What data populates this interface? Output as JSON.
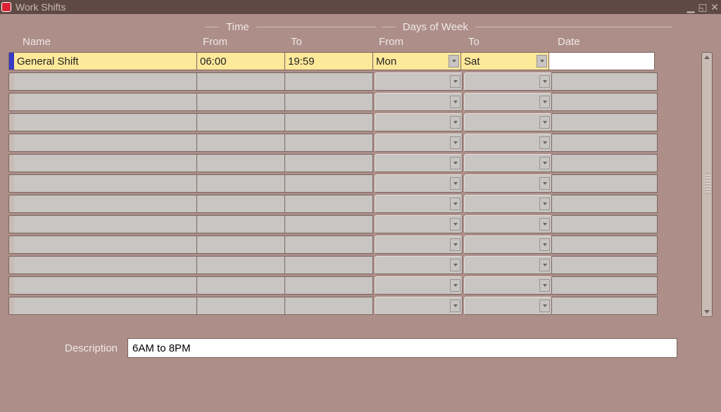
{
  "window": {
    "title": "Work Shifts"
  },
  "groups": {
    "time": "Time",
    "dow": "Days of Week"
  },
  "columns": {
    "name": "Name",
    "from": "From",
    "to": "To",
    "dfrom": "From",
    "dto": "To",
    "date": "Date"
  },
  "rows": [
    {
      "selected": true,
      "name": "General Shift",
      "from": "06:00",
      "to": "19:59",
      "dfrom": "Mon",
      "dto": "Sat",
      "date": ""
    },
    {
      "selected": false,
      "name": "",
      "from": "",
      "to": "",
      "dfrom": "",
      "dto": "",
      "date": ""
    },
    {
      "selected": false,
      "name": "",
      "from": "",
      "to": "",
      "dfrom": "",
      "dto": "",
      "date": ""
    },
    {
      "selected": false,
      "name": "",
      "from": "",
      "to": "",
      "dfrom": "",
      "dto": "",
      "date": ""
    },
    {
      "selected": false,
      "name": "",
      "from": "",
      "to": "",
      "dfrom": "",
      "dto": "",
      "date": ""
    },
    {
      "selected": false,
      "name": "",
      "from": "",
      "to": "",
      "dfrom": "",
      "dto": "",
      "date": ""
    },
    {
      "selected": false,
      "name": "",
      "from": "",
      "to": "",
      "dfrom": "",
      "dto": "",
      "date": ""
    },
    {
      "selected": false,
      "name": "",
      "from": "",
      "to": "",
      "dfrom": "",
      "dto": "",
      "date": ""
    },
    {
      "selected": false,
      "name": "",
      "from": "",
      "to": "",
      "dfrom": "",
      "dto": "",
      "date": ""
    },
    {
      "selected": false,
      "name": "",
      "from": "",
      "to": "",
      "dfrom": "",
      "dto": "",
      "date": ""
    },
    {
      "selected": false,
      "name": "",
      "from": "",
      "to": "",
      "dfrom": "",
      "dto": "",
      "date": ""
    },
    {
      "selected": false,
      "name": "",
      "from": "",
      "to": "",
      "dfrom": "",
      "dto": "",
      "date": ""
    },
    {
      "selected": false,
      "name": "",
      "from": "",
      "to": "",
      "dfrom": "",
      "dto": "",
      "date": ""
    }
  ],
  "description": {
    "label": "Description",
    "value": "6AM to 8PM"
  }
}
